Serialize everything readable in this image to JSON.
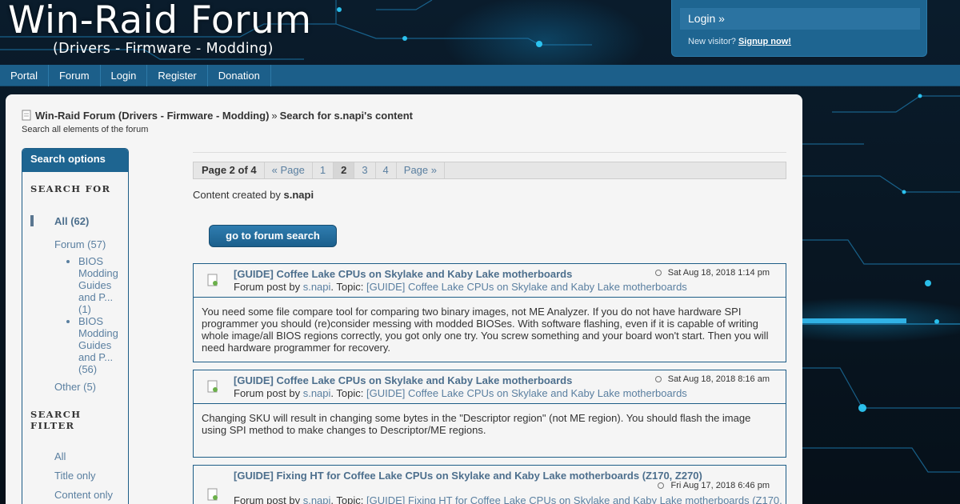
{
  "header": {
    "title": "Win-Raid Forum",
    "subtitle": "(Drivers - Firmware - Modding)",
    "login_label": "Login »",
    "new_visitor": "New visitor?",
    "signup_label": "Signup now!"
  },
  "nav": [
    "Portal",
    "Forum",
    "Login",
    "Register",
    "Donation"
  ],
  "breadcrumb": {
    "home": "Win-Raid Forum (Drivers - Firmware - Modding)",
    "sep": "»",
    "current": "Search for s.napi's content",
    "sub": "Search all elements of the forum"
  },
  "sidebar": {
    "head": "Search options",
    "search_for_label": "SEARCH FOR",
    "all": "All (62)",
    "forum": "Forum (57)",
    "forum_subs": [
      "BIOS Modding Guides and P... (1)",
      "BIOS Modding Guides and P... (56)"
    ],
    "other": "Other (5)",
    "filter_label": "SEARCH FILTER",
    "filters": [
      "All",
      "Title only",
      "Content only"
    ]
  },
  "pager": {
    "label": "Page 2 of 4",
    "prev": "« Page",
    "pages": [
      "1",
      "2",
      "3",
      "4"
    ],
    "current": "2",
    "next": "Page »"
  },
  "created_by_prefix": "Content created by",
  "created_by_user": "s.napi",
  "search_button": "go to forum search",
  "posts": [
    {
      "title": "[GUIDE] Coffee Lake CPUs on Skylake and Kaby Lake motherboards",
      "date": "Sat Aug 18, 2018 1:14 pm",
      "meta_prefix": "Forum post by",
      "user": "s.napi",
      "topic_prefix": ". Topic:",
      "topic": "[GUIDE] Coffee Lake CPUs on Skylake and Kaby Lake motherboards",
      "body": "You need some file compare tool for comparing two binary images, not ME Analyzer. If you do not have hardware SPI programmer you should (re)consider messing with modded BIOSes. With software flashing, even if it is capable of writing whole image/all BIOS regions correctly, you got only one try. You screw something and your board won't start. Then you will need hardware programmer for recovery."
    },
    {
      "title": "[GUIDE] Coffee Lake CPUs on Skylake and Kaby Lake motherboards",
      "date": "Sat Aug 18, 2018 8:16 am",
      "meta_prefix": "Forum post by",
      "user": "s.napi",
      "topic_prefix": ". Topic:",
      "topic": "[GUIDE] Coffee Lake CPUs on Skylake and Kaby Lake motherboards",
      "body": "Changing SKU will result in changing some bytes in the \"Descriptor region\" (not ME region). You should flash the image using SPI method to make changes to Descriptor/ME regions."
    },
    {
      "title": "[GUIDE] Fixing HT for Coffee Lake CPUs on Skylake and Kaby Lake motherboards (Z170, Z270)",
      "date": "Fri Aug 17, 2018 6:46 pm",
      "meta_prefix": "Forum post by",
      "user": "s.napi",
      "topic_prefix": ". Topic:",
      "topic": "[GUIDE] Fixing HT for Coffee Lake CPUs on Skylake and Kaby Lake motherboards (Z170,",
      "body": ""
    }
  ]
}
